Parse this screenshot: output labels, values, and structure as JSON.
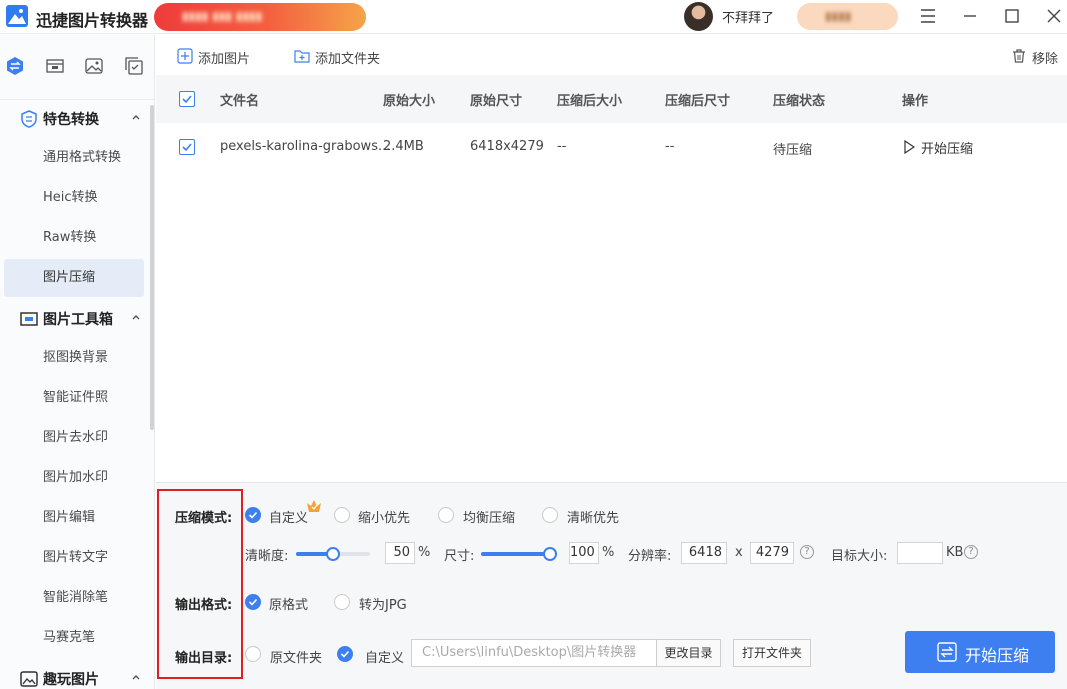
{
  "app": {
    "title": "迅捷图片转换器",
    "username": "不拜拜了"
  },
  "sidebar": {
    "top_icons": [
      "convert-icon",
      "crop-icon",
      "image-icon",
      "copy-icon"
    ],
    "groups": [
      {
        "label": "特色转换",
        "items": [
          {
            "label": "通用格式转换"
          },
          {
            "label": "Heic转换"
          },
          {
            "label": "Raw转换"
          },
          {
            "label": "图片压缩",
            "active": true
          }
        ]
      },
      {
        "label": "图片工具箱",
        "items": [
          {
            "label": "抠图换背景"
          },
          {
            "label": "智能证件照"
          },
          {
            "label": "图片去水印"
          },
          {
            "label": "图片加水印"
          },
          {
            "label": "图片编辑"
          },
          {
            "label": "图片转文字"
          },
          {
            "label": "智能消除笔"
          },
          {
            "label": "马赛克笔"
          }
        ]
      },
      {
        "label": "趣玩图片",
        "items": []
      }
    ]
  },
  "toolbar": {
    "add_image": "添加图片",
    "add_folder": "添加文件夹",
    "remove": "移除"
  },
  "table": {
    "headers": [
      "文件名",
      "原始大小",
      "原始尺寸",
      "压缩后大小",
      "压缩后尺寸",
      "压缩状态",
      "操作"
    ],
    "rows": [
      {
        "checked": true,
        "filename": "pexels-karolina-grabows...",
        "orig_size": "2.4MB",
        "orig_dims": "6418x4279",
        "comp_size": "--",
        "comp_dims": "--",
        "status": "待压缩",
        "action": "开始压缩"
      }
    ]
  },
  "settings": {
    "mode_label": "压缩模式:",
    "modes": [
      {
        "label": "自定义",
        "checked": true
      },
      {
        "label": "缩小优先",
        "checked": false
      },
      {
        "label": "均衡压缩",
        "checked": false
      },
      {
        "label": "清晰优先",
        "checked": false
      }
    ],
    "clarity_label": "清晰度:",
    "clarity_value": "50",
    "clarity_fraction": 0.5,
    "size_label": "尺寸:",
    "size_value": "100",
    "size_fraction": 1.0,
    "percent": "%",
    "resolution_label": "分辨率:",
    "res_width": "6418",
    "res_x": "x",
    "res_height": "4279",
    "target_label": "目标大小:",
    "target_value": "",
    "target_unit": "KB",
    "help_glyph": "?",
    "format_label": "输出格式:",
    "formats": [
      {
        "label": "原格式",
        "checked": true
      },
      {
        "label": "转为JPG",
        "checked": false
      }
    ],
    "dir_label": "输出目录:",
    "dirs": [
      {
        "label": "原文件夹",
        "checked": false
      },
      {
        "label": "自定义",
        "checked": true
      }
    ],
    "path": "C:\\Users\\linfu\\Desktop\\图片转换器",
    "change_dir": "更改目录",
    "open_folder": "打开文件夹",
    "start_button": "开始压缩"
  },
  "colors": {
    "accent": "#3d7ff0",
    "highlight_border": "#e02020",
    "promo_start": "#ef3b3b",
    "promo_end": "#f5a44a"
  }
}
